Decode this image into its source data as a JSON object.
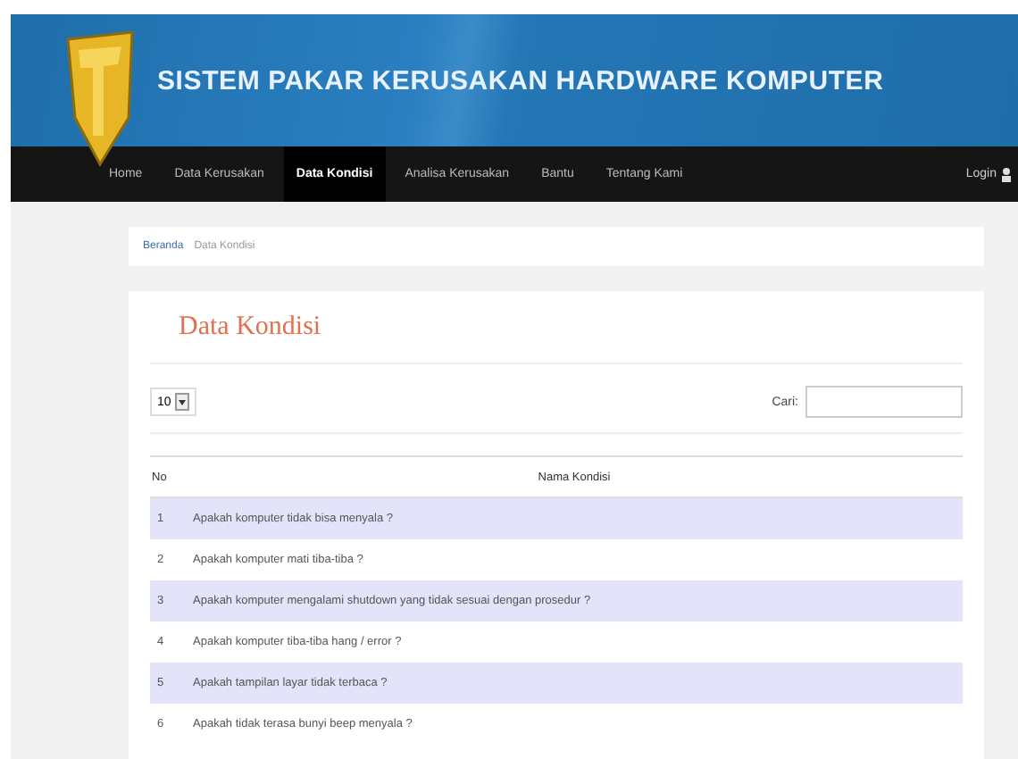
{
  "header": {
    "title": "SISTEM PAKAR KERUSAKAN HARDWARE KOMPUTER"
  },
  "nav": {
    "items": [
      {
        "label": "Home",
        "selected": false
      },
      {
        "label": "Data Kerusakan",
        "selected": false
      },
      {
        "label": "Data Kondisi",
        "selected": true
      },
      {
        "label": "Analisa Kerusakan",
        "selected": false
      },
      {
        "label": "Bantu",
        "selected": false
      },
      {
        "label": "Tentang Kami",
        "selected": false
      }
    ],
    "login": "Login"
  },
  "breadcrumb": [
    {
      "label": "Beranda",
      "kind": "link"
    },
    {
      "label": "Data Kondisi",
      "kind": "current"
    }
  ],
  "panel": {
    "title": "Data Kondisi",
    "page_size": "10",
    "search_label": "Cari:",
    "table": {
      "columns": [
        "No",
        "Nama Kondisi"
      ],
      "rows": [
        [
          "1",
          "Apakah komputer tidak bisa menyala ?"
        ],
        [
          "2",
          "Apakah komputer mati tiba-tiba ?"
        ],
        [
          "3",
          "Apakah komputer mengalami shutdown yang tidak sesuai dengan prosedur ?"
        ],
        [
          "4",
          "Apakah komputer tiba-tiba hang / error ?"
        ],
        [
          "5",
          "Apakah tampilan layar tidak terbaca ?"
        ],
        [
          "6",
          "Apakah tidak terasa bunyi beep menyala ?"
        ]
      ]
    }
  }
}
